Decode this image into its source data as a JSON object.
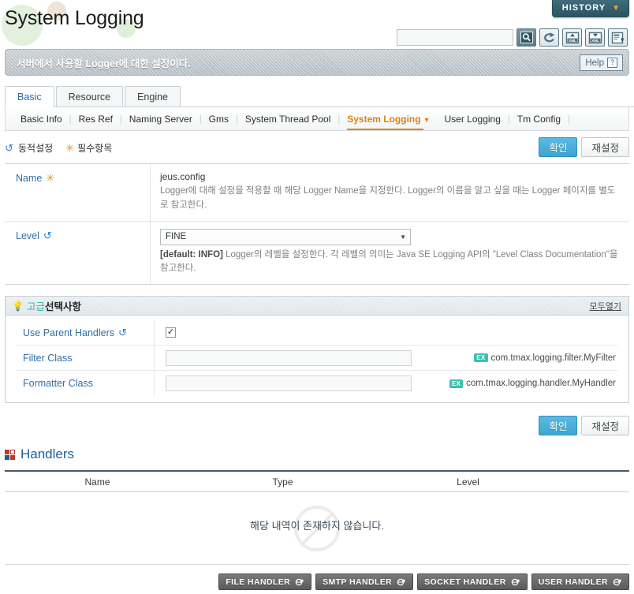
{
  "header": {
    "title": "System Logging",
    "history_label": "HISTORY",
    "history_caret": "chevron-down-icon",
    "search_value": "",
    "search_placeholder": "",
    "toolbar_icons": [
      {
        "name": "search-icon",
        "label": ""
      },
      {
        "name": "refresh-icon",
        "label": ""
      },
      {
        "name": "xml-import-icon",
        "label": "XML"
      },
      {
        "name": "xml-export-icon",
        "label": "XML"
      },
      {
        "name": "report-export-icon",
        "label": ""
      }
    ]
  },
  "infobar": {
    "message": "서버에서 사용할 Logger에 대한 설정이다.",
    "help_label": "Help",
    "help_icon": "?"
  },
  "tabs": [
    {
      "label": "Basic",
      "active": true
    },
    {
      "label": "Resource",
      "active": false
    },
    {
      "label": "Engine",
      "active": false
    }
  ],
  "subnav": [
    {
      "label": "Basic Info",
      "active": false
    },
    {
      "label": "Res Ref",
      "active": false
    },
    {
      "label": "Naming Server",
      "active": false
    },
    {
      "label": "Gms",
      "active": false
    },
    {
      "label": "System Thread Pool",
      "active": false
    },
    {
      "label": "System Logging",
      "active": true
    },
    {
      "label": "User Logging",
      "active": false
    },
    {
      "label": "Tm Config",
      "active": false
    }
  ],
  "legend": {
    "dynamic": "동적설정",
    "required": "필수항목"
  },
  "buttons": {
    "confirm": "확인",
    "reset": "재설정"
  },
  "form": {
    "rows": [
      {
        "label": "Name",
        "marker": "required",
        "value": "jeus.config",
        "desc": "Logger에 대해 설정을 적용할 때 해당 Logger Name을 지정한다. Logger의 이름을 알고 싶을 때는 Logger 페이지를 별도로 참고한다."
      },
      {
        "label": "Level",
        "marker": "dynamic",
        "select_value": "FINE",
        "desc_default": "[default: INFO]",
        "desc": "Logger의 레벨을 설정한다. 각 레벨의 의미는 Java SE Logging API의 \"Level Class Documentation\"을 참고한다."
      }
    ]
  },
  "advanced": {
    "title_teal": "고급",
    "title_dark": "선택사항",
    "open_all": "모두열기",
    "rows": [
      {
        "label": "Use Parent Handlers",
        "marker": "dynamic",
        "type": "checkbox",
        "checked": true,
        "value": "",
        "example_badge": "",
        "example_text": ""
      },
      {
        "label": "Filter Class",
        "marker": "none",
        "type": "text",
        "checked": false,
        "value": "",
        "example_badge": "EX",
        "example_text": "com.tmax.logging.filter.MyFilter"
      },
      {
        "label": "Formatter Class",
        "marker": "none",
        "type": "text",
        "checked": false,
        "value": "",
        "example_badge": "EX",
        "example_text": "com.tmax.logging.handler.MyHandler"
      }
    ]
  },
  "handlers": {
    "section_title": "Handlers",
    "columns": [
      "Name",
      "Type",
      "Level"
    ],
    "rows": [],
    "empty_message": "해당 내역이 존재하지 않습니다.",
    "action_buttons": [
      {
        "label": "FILE HANDLER"
      },
      {
        "label": "SMTP HANDLER"
      },
      {
        "label": "SOCKET HANDLER"
      },
      {
        "label": "USER HANDLER"
      }
    ]
  },
  "colors": {
    "accent_blue": "#2f6fa8",
    "primary_button": "#3da5d4",
    "active_nav_orange": "#e08214",
    "teal": "#33b3a6",
    "history_tab": "#2c5361"
  }
}
